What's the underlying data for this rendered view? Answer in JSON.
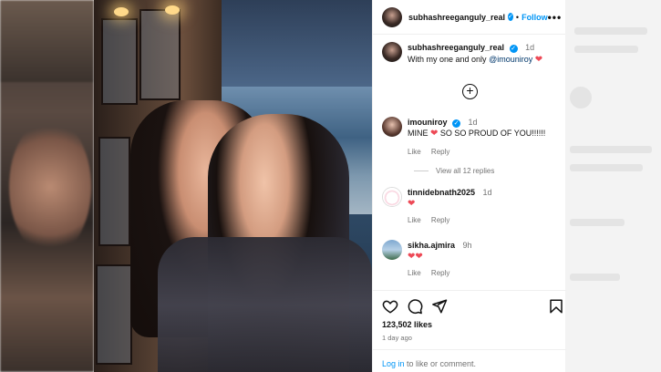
{
  "post": {
    "author": "subhashreeganguly_real",
    "follow_label": "Follow",
    "more_label": "•••",
    "dot": "•",
    "caption_text": "With my one and only",
    "caption_mention": "@imouniroy",
    "caption_time": "1d",
    "add_comment_icon": "plus-circle-icon"
  },
  "comments": [
    {
      "user": "imouniroy",
      "verified": true,
      "time": "1d",
      "text": "MINE",
      "text2": "SO SO PROUD OF YOU!!!!!!",
      "like": "Like",
      "reply": "Reply",
      "view_replies": "View all 12 replies"
    },
    {
      "user": "tinnidebnath2025",
      "time": "1d",
      "like": "Like",
      "reply": "Reply"
    },
    {
      "user": "sikha.ajmira",
      "time": "9h",
      "like": "Like",
      "reply": "Reply"
    }
  ],
  "engagement": {
    "likes": "123,502 likes",
    "posted": "1 day ago",
    "login_link": "Log in",
    "login_rest": " to like or comment."
  },
  "colors": {
    "accent": "#0095f6",
    "heart": "#ed4956",
    "muted": "#737373"
  }
}
